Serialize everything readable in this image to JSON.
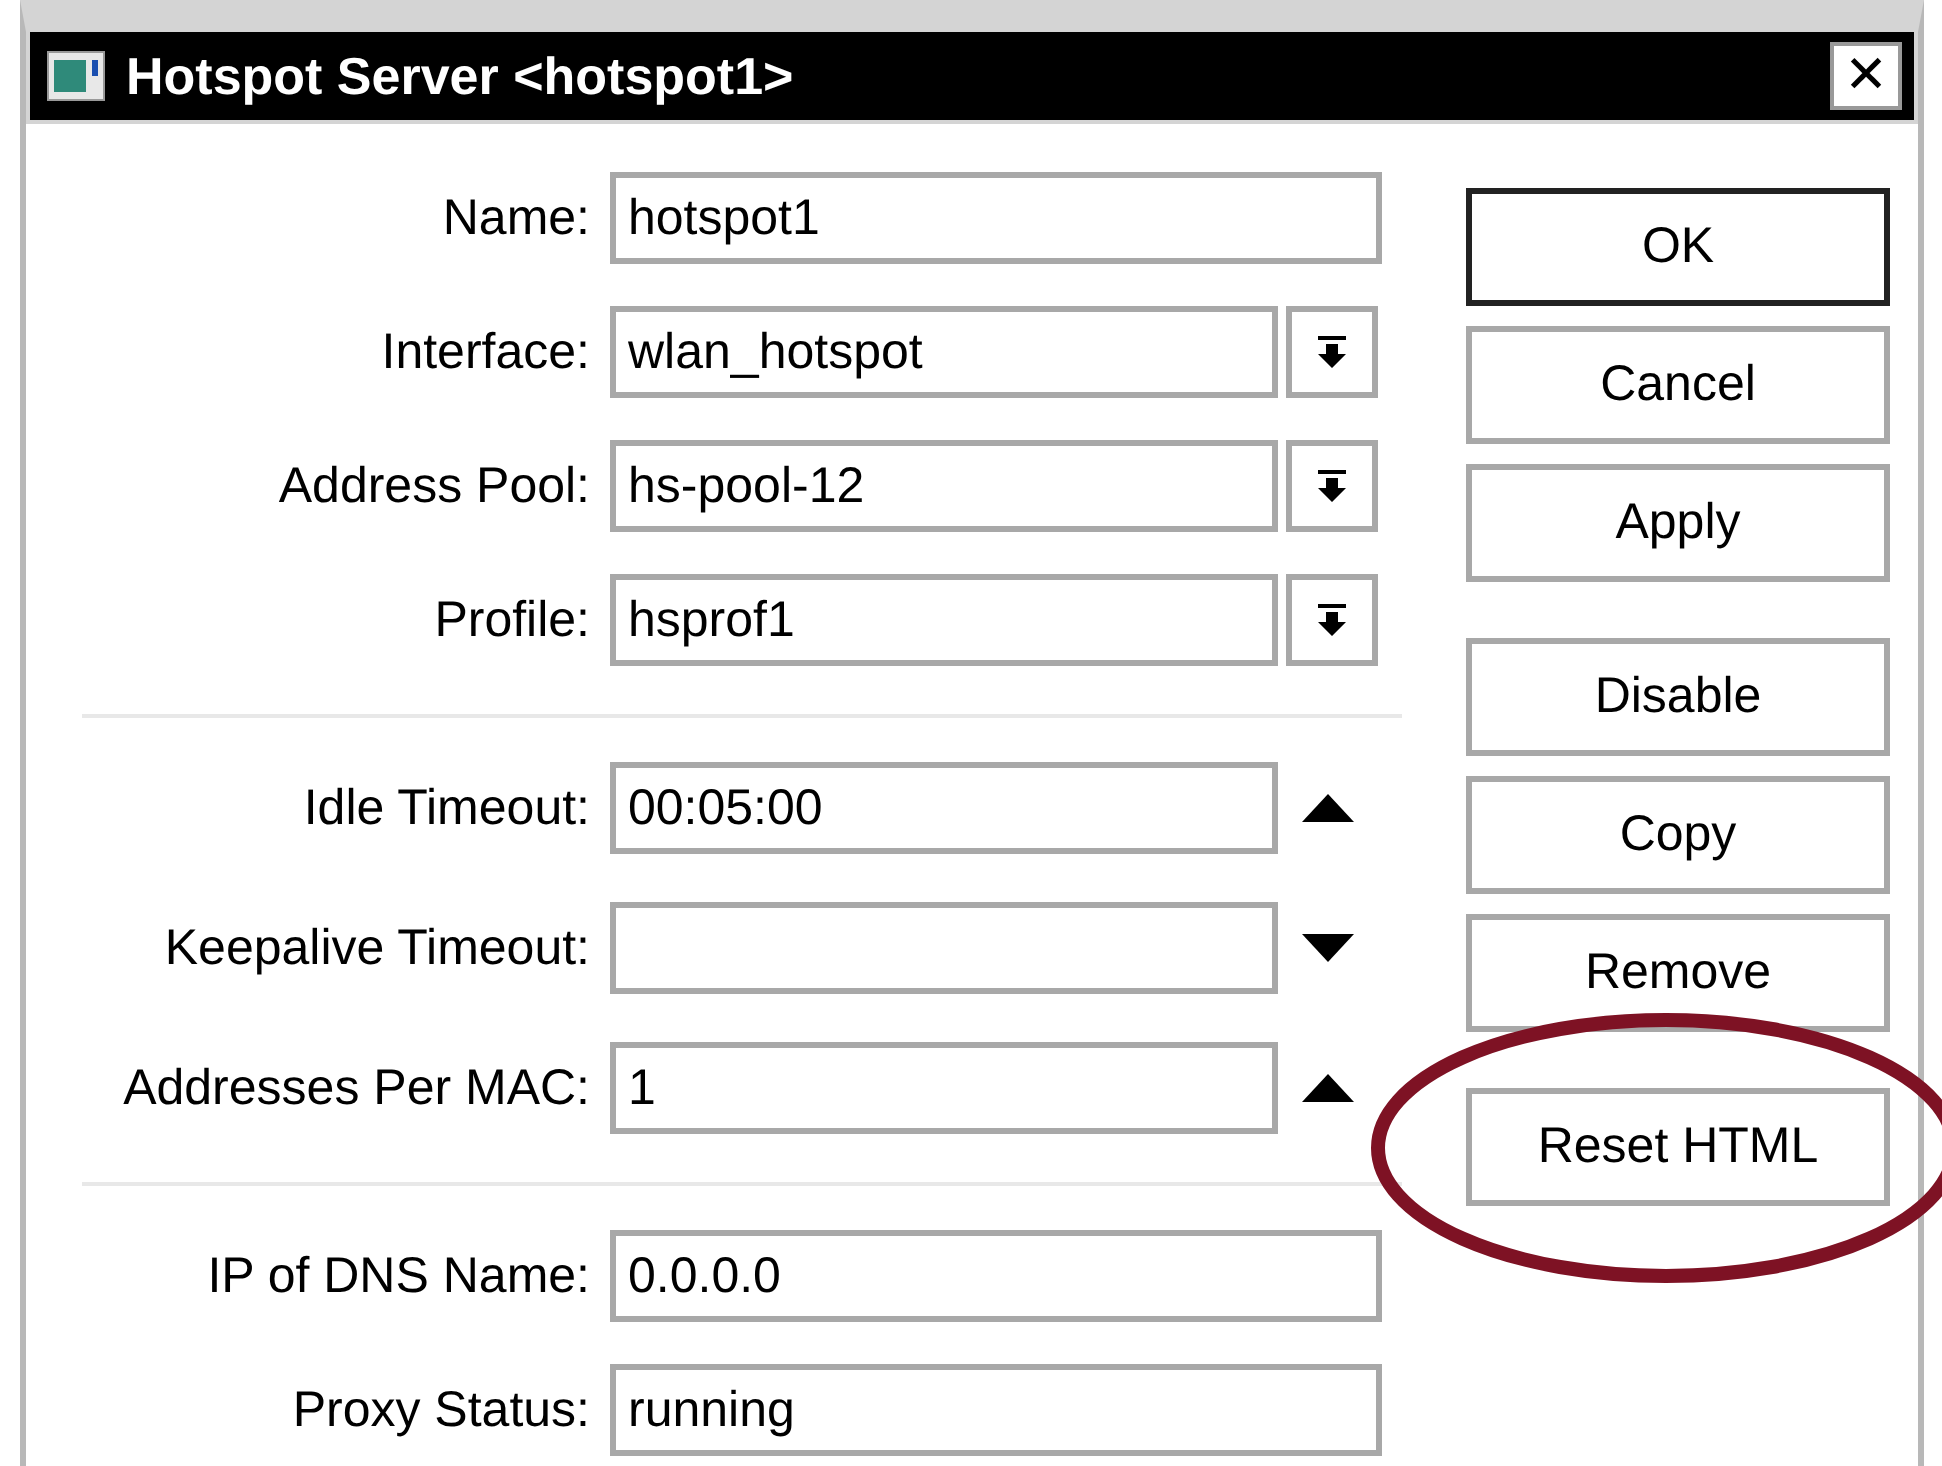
{
  "window": {
    "title": "Hotspot Server <hotspot1>",
    "close": "✕"
  },
  "sections": [
    {
      "rows": [
        {
          "label": "Name:",
          "kind": "text",
          "value": "hotspot1"
        },
        {
          "label": "Interface:",
          "kind": "dropdown",
          "value": "wlan_hotspot"
        },
        {
          "label": "Address Pool:",
          "kind": "dropdown",
          "value": "hs-pool-12"
        },
        {
          "label": "Profile:",
          "kind": "dropdown",
          "value": "hsprof1"
        }
      ]
    },
    {
      "rows": [
        {
          "label": "Idle Timeout:",
          "kind": "spin_up",
          "value": "00:05:00"
        },
        {
          "label": "Keepalive Timeout:",
          "kind": "spin_down",
          "value": ""
        },
        {
          "label": "Addresses Per MAC:",
          "kind": "spin_up",
          "value": "1"
        }
      ]
    },
    {
      "rows": [
        {
          "label": "IP of DNS Name:",
          "kind": "text",
          "value": "0.0.0.0"
        },
        {
          "label": "Proxy Status:",
          "kind": "text",
          "value": "running"
        }
      ]
    }
  ],
  "button_groups": [
    {
      "buttons": [
        {
          "label": "OK",
          "default": true,
          "highlighted": false
        },
        {
          "label": "Cancel",
          "default": false,
          "highlighted": false
        },
        {
          "label": "Apply",
          "default": false,
          "highlighted": false
        }
      ]
    },
    {
      "buttons": [
        {
          "label": "Disable",
          "default": false,
          "highlighted": false
        },
        {
          "label": "Copy",
          "default": false,
          "highlighted": false
        },
        {
          "label": "Remove",
          "default": false,
          "highlighted": false
        }
      ]
    },
    {
      "buttons": [
        {
          "label": "Reset HTML",
          "default": false,
          "highlighted": true
        }
      ]
    }
  ]
}
